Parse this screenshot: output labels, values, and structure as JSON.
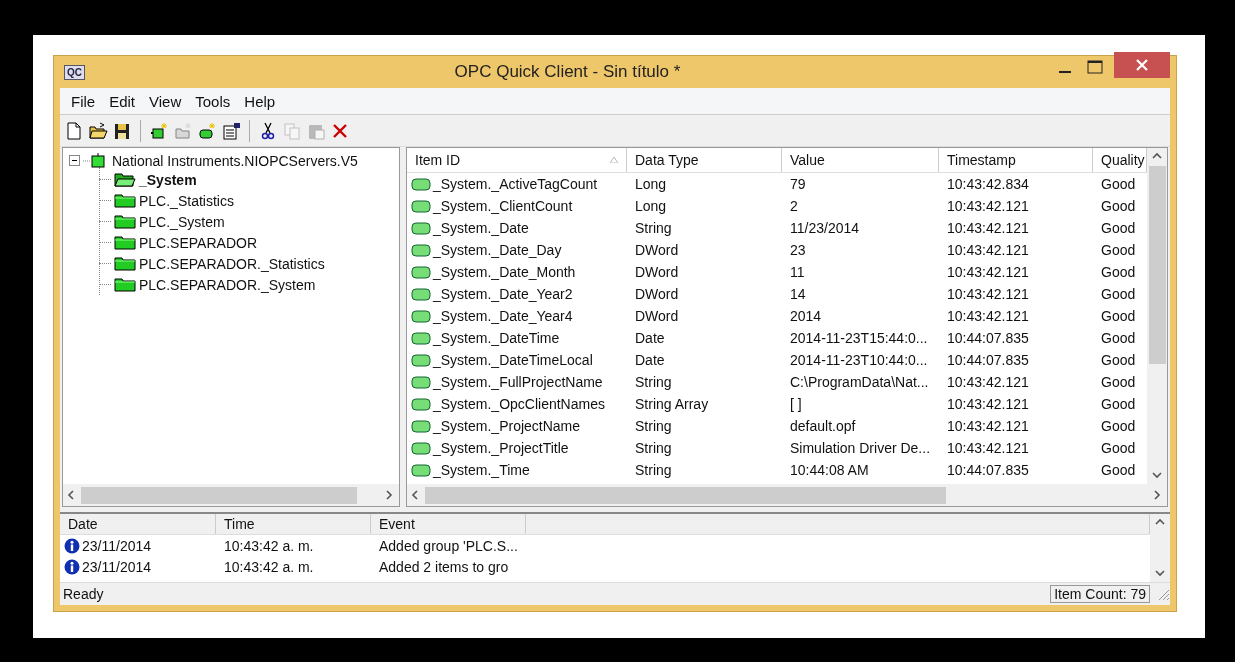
{
  "window": {
    "title": "OPC Quick Client - Sin título *",
    "logo": "QC"
  },
  "menu": [
    "File",
    "Edit",
    "View",
    "Tools",
    "Help"
  ],
  "toolbar": [
    {
      "kind": "new",
      "disabled": false
    },
    {
      "kind": "open",
      "disabled": false
    },
    {
      "kind": "save",
      "disabled": false
    },
    {
      "kind": "separator",
      "disabled": false
    },
    {
      "kind": "new-server",
      "disabled": false
    },
    {
      "kind": "new-group",
      "disabled": true
    },
    {
      "kind": "new-item",
      "disabled": false
    },
    {
      "kind": "properties",
      "disabled": false
    },
    {
      "kind": "separator",
      "disabled": false
    },
    {
      "kind": "cut",
      "disabled": false
    },
    {
      "kind": "copy",
      "disabled": true
    },
    {
      "kind": "paste",
      "disabled": true
    },
    {
      "kind": "delete",
      "disabled": false
    }
  ],
  "tree": {
    "label": "National Instruments.NIOPCServers.V5",
    "expanded": true,
    "selected": false,
    "children": [
      {
        "label": "_System",
        "selected": true
      },
      {
        "label": "PLC._Statistics",
        "selected": false
      },
      {
        "label": "PLC._System",
        "selected": false
      },
      {
        "label": "PLC.SEPARADOR",
        "selected": false
      },
      {
        "label": "PLC.SEPARADOR._Statistics",
        "selected": false
      },
      {
        "label": "PLC.SEPARADOR._System",
        "selected": false
      }
    ]
  },
  "items": {
    "columns": [
      "Item ID",
      "Data Type",
      "Value",
      "Timestamp",
      "Quality"
    ],
    "rows": [
      [
        "_System._ActiveTagCount",
        "Long",
        "79",
        "10:43:42.834",
        "Good"
      ],
      [
        "_System._ClientCount",
        "Long",
        "2",
        "10:43:42.121",
        "Good"
      ],
      [
        "_System._Date",
        "String",
        "11/23/2014",
        "10:43:42.121",
        "Good"
      ],
      [
        "_System._Date_Day",
        "DWord",
        "23",
        "10:43:42.121",
        "Good"
      ],
      [
        "_System._Date_Month",
        "DWord",
        "11",
        "10:43:42.121",
        "Good"
      ],
      [
        "_System._Date_Year2",
        "DWord",
        "14",
        "10:43:42.121",
        "Good"
      ],
      [
        "_System._Date_Year4",
        "DWord",
        "2014",
        "10:43:42.121",
        "Good"
      ],
      [
        "_System._DateTime",
        "Date",
        "2014-11-23T15:44:0...",
        "10:44:07.835",
        "Good"
      ],
      [
        "_System._DateTimeLocal",
        "Date",
        "2014-11-23T10:44:0...",
        "10:44:07.835",
        "Good"
      ],
      [
        "_System._FullProjectName",
        "String",
        "C:\\ProgramData\\Nat...",
        "10:43:42.121",
        "Good"
      ],
      [
        "_System._OpcClientNames",
        "String Array",
        "[ ]",
        "10:43:42.121",
        "Good"
      ],
      [
        "_System._ProjectName",
        "String",
        "default.opf",
        "10:43:42.121",
        "Good"
      ],
      [
        "_System._ProjectTitle",
        "String",
        "Simulation Driver De...",
        "10:43:42.121",
        "Good"
      ],
      [
        "_System._Time",
        "String",
        "10:44:08 AM",
        "10:44:07.835",
        "Good"
      ]
    ]
  },
  "log": {
    "columns": [
      "Date",
      "Time",
      "Event"
    ],
    "rows": [
      {
        "kind": "info",
        "cells": [
          "23/11/2014",
          "10:43:42 a. m.",
          "Added group 'PLC.S..."
        ]
      },
      {
        "kind": "info",
        "cells": [
          "23/11/2014",
          "10:43:42 a. m.",
          "Added 2 items to gro"
        ]
      }
    ]
  },
  "status": {
    "text": "Ready",
    "item_count": "Item Count: 79"
  }
}
